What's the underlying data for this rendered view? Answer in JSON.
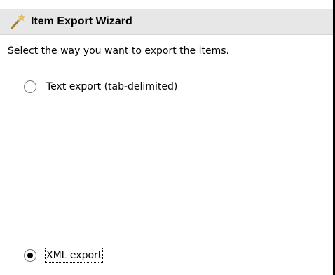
{
  "window": {
    "title": "Item Export Wizard",
    "icon": "magic-wand-icon"
  },
  "instruction": "Select the way you want to export the items.",
  "options": [
    {
      "label": "Text export (tab-delimited)",
      "selected": false
    },
    {
      "label": "XML export",
      "selected": true
    }
  ],
  "colors": {
    "title_bar_bg": "#e7e7e7",
    "wand_handle": "#a37b2c",
    "wand_tip": "#f2c94c"
  }
}
